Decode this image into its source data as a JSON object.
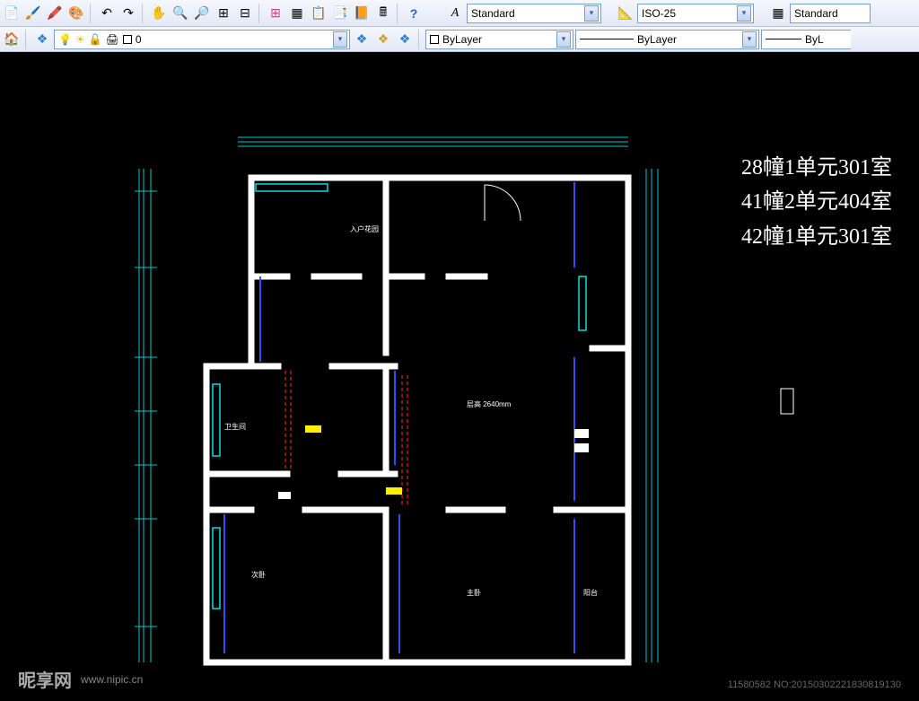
{
  "toolbar1": {
    "style_selector": {
      "value": "Standard"
    },
    "dim_selector": {
      "value": "ISO-25"
    },
    "style2_selector": {
      "value": "Standard"
    }
  },
  "toolbar2": {
    "layer_selector": {
      "value": "0"
    },
    "color_selector": {
      "value": "ByLayer"
    },
    "linetype_selector": {
      "value": "ByLayer"
    },
    "lineweight_selector": {
      "value": "ByL"
    }
  },
  "side_labels": {
    "line1": "28幢1单元301室",
    "line2": "41幢2单元404室",
    "line3": "42幢1单元301室"
  },
  "room_labels": {
    "entry": "入户花园",
    "living": "层高 2640mm"
  },
  "watermark": {
    "brand": "昵享网",
    "url": "www.nipic.cn",
    "id": "11580582",
    "no": "NO:20150302221830819130"
  }
}
